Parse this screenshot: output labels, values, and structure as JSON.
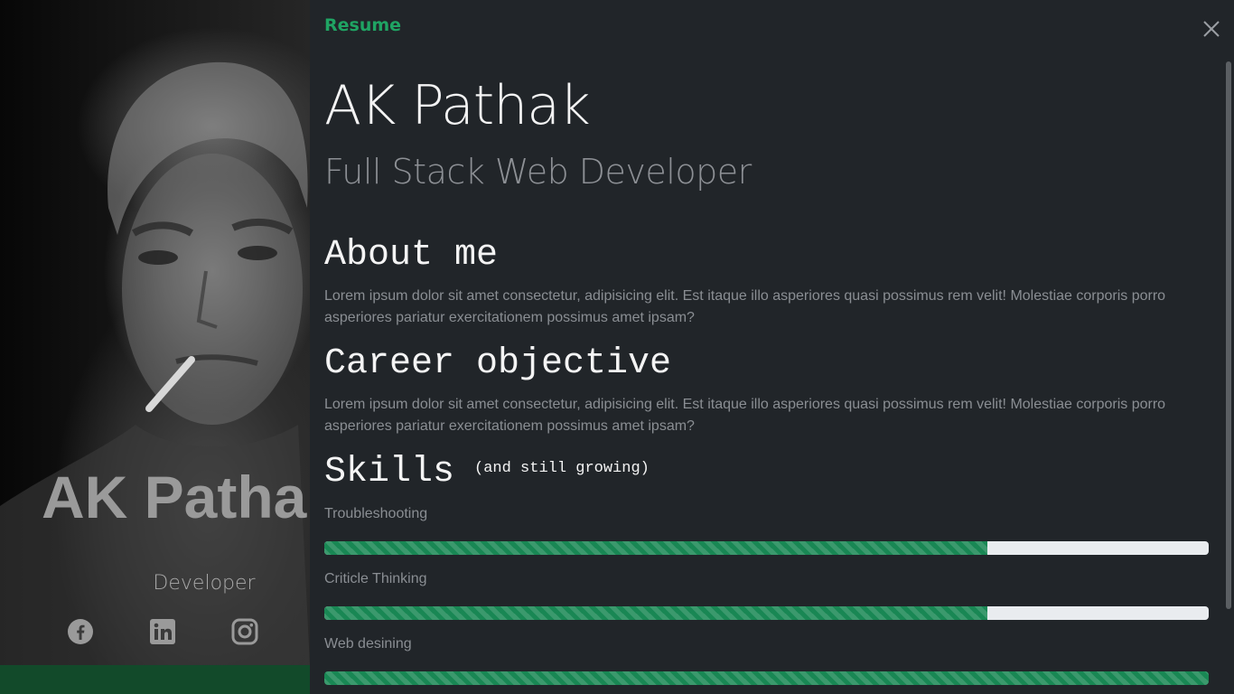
{
  "hero": {
    "name": "AK Pathak",
    "role": "Developer",
    "social_icons": [
      "facebook-icon",
      "linkedin-icon",
      "instagram-icon"
    ]
  },
  "panel": {
    "title": "Resume",
    "name": "AK Pathak",
    "role": "Full Stack Web Developer",
    "about": {
      "heading": "About me",
      "text": "Lorem ipsum dolor sit amet consectetur, adipisicing elit. Est itaque illo asperiores quasi possimus rem velit! Molestiae corporis porro asperiores pariatur exercitationem possimus amet ipsam?"
    },
    "career": {
      "heading": "Career objective",
      "text": "Lorem ipsum dolor sit amet consectetur, adipisicing elit. Est itaque illo asperiores quasi possimus rem velit! Molestiae corporis porro asperiores pariatur exercitationem possimus amet ipsam?"
    },
    "skills": {
      "heading": "Skills",
      "subheading": "(and still growing)",
      "items": [
        {
          "label": "Troubleshooting",
          "percent": 75
        },
        {
          "label": "Criticle Thinking",
          "percent": 75
        },
        {
          "label": "Web desining",
          "percent": 100
        }
      ]
    }
  },
  "colors": {
    "accent": "#1fa463",
    "progress": "#198754",
    "panel_bg": "#212529",
    "muted_text": "#8a8e93"
  }
}
